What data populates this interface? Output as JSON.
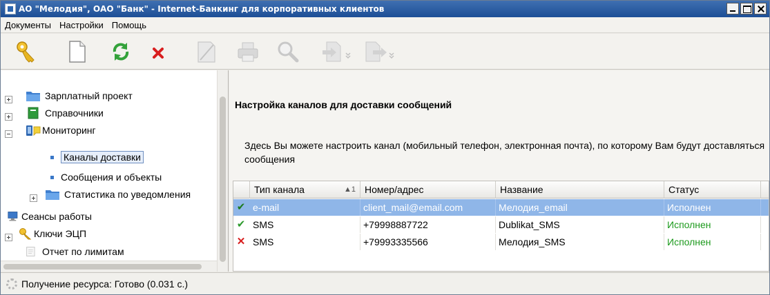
{
  "window": {
    "title": "АО \"Мелодия\", ОАО \"Банк\" - Internet-Банкинг для корпоративных клиентов"
  },
  "menu": [
    "Документы",
    "Настройки",
    "Помощь"
  ],
  "toolbar": {
    "buttons": [
      {
        "name": "keys-icon",
        "enabled": true
      },
      {
        "name": "new-document-icon",
        "enabled": true
      },
      {
        "name": "refresh-icon",
        "enabled": true
      },
      {
        "name": "delete-icon",
        "enabled": true
      },
      {
        "name": "sign-icon",
        "enabled": false
      },
      {
        "name": "print-icon",
        "enabled": false
      },
      {
        "name": "search-icon",
        "enabled": false
      },
      {
        "name": "import-icon",
        "enabled": false
      },
      {
        "name": "export-icon",
        "enabled": false
      }
    ]
  },
  "tree": {
    "items": [
      {
        "label": "Зарплатный проект",
        "icon": "folder-icon",
        "expander": "plus"
      },
      {
        "label": "Справочники",
        "icon": "book-icon",
        "expander": "plus"
      },
      {
        "label": "Мониторинг",
        "icon": "monitoring-icon",
        "expander": "minus"
      },
      {
        "label": "Каналы доставки",
        "icon": "bullet",
        "selected": true
      },
      {
        "label": "Сообщения и объекты",
        "icon": "bullet"
      },
      {
        "label": "Статистика по уведомления",
        "icon": "folder-icon",
        "expander": "plus"
      },
      {
        "label": "Сеансы работы",
        "icon": "monitor-icon"
      },
      {
        "label": "Ключи ЭЦП",
        "icon": "keys-icon",
        "expander": "plus"
      },
      {
        "label": "Отчет по лимитам",
        "icon": "report-icon"
      }
    ]
  },
  "main": {
    "heading": "Настройка каналов для доставки сообщений",
    "description": "Здесь Вы можете настроить канал (мобильный телефон, электронная почта), по которому Вам будут доставляться сообщения",
    "table": {
      "columns": [
        "Тип канала",
        "Номер/адрес",
        "Название",
        "Статус"
      ],
      "sort_indicator": "▲1",
      "rows": [
        {
          "mark": "check",
          "type": "e-mail",
          "address": "client_mail@email.com",
          "name": "Мелодия_email",
          "status": "Исполнен",
          "selected": true
        },
        {
          "mark": "check",
          "type": "SMS",
          "address": "+79998887722",
          "name": "Dublikat_SMS",
          "status": "Исполнен"
        },
        {
          "mark": "cross",
          "type": "SMS",
          "address": "+79993335566",
          "name": "Мелодия_SMS",
          "status": "Исполнен"
        }
      ]
    }
  },
  "status_bar": {
    "text": "Получение ресурса: Готово (0.031 с.)"
  },
  "colors": {
    "title_bar": "#2d5ea6",
    "selection": "#8fb6e8",
    "status_ok": "#1d9a1d",
    "error_mark": "#d81e1e"
  }
}
